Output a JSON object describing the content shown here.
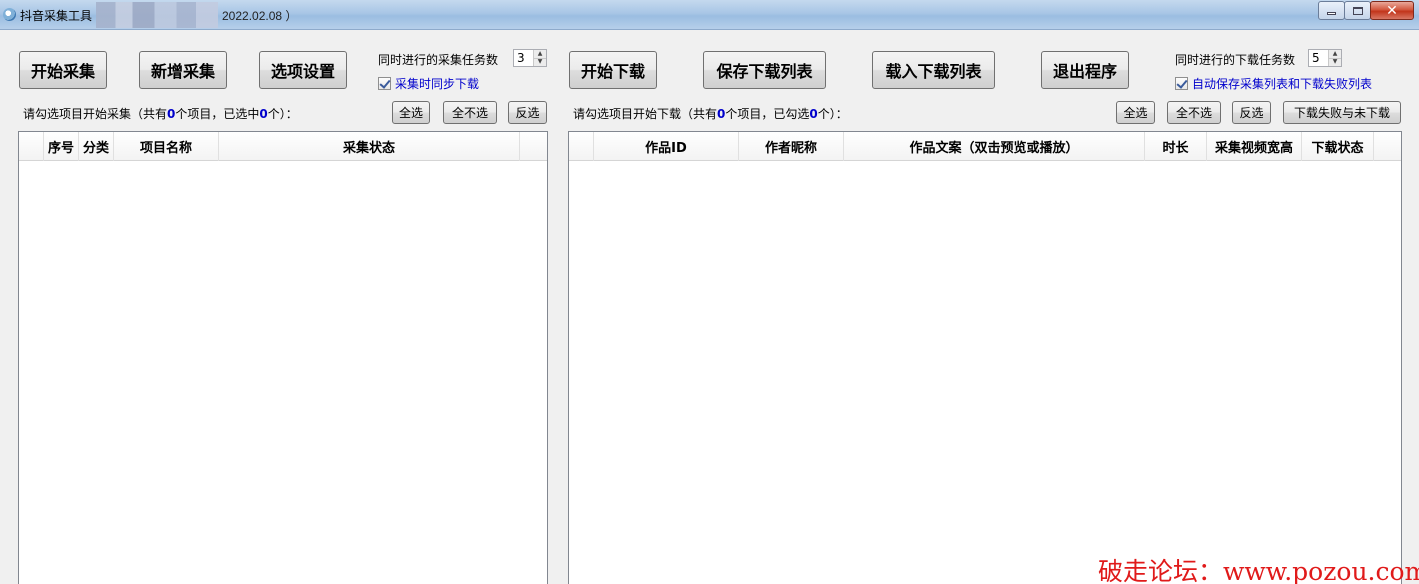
{
  "window": {
    "title": "抖音采集工具",
    "version": "2022.02.08 ）",
    "min_label": "",
    "max_label": "",
    "close_label": "✕"
  },
  "left": {
    "buttons": {
      "start_collect": "开始采集",
      "add_collect": "新增采集",
      "options": "选项设置"
    },
    "concurrent_label": "同时进行的采集任务数",
    "concurrent_value": "3",
    "sync_download_label": "采集时同步下载",
    "status": {
      "prefix": "请勾选项目开始采集（共有",
      "total": "0",
      "middle": "个项目，已选中",
      "selected": "0",
      "suffix": "个）："
    },
    "select_all": "全选",
    "select_none": "全不选",
    "invert": "反选",
    "columns": [
      "",
      "序号",
      "分类",
      "项目名称",
      "采集状态",
      ""
    ]
  },
  "right": {
    "buttons": {
      "start_download": "开始下载",
      "save_list": "保存下载列表",
      "load_list": "载入下载列表",
      "exit": "退出程序"
    },
    "concurrent_label": "同时进行的下载任务数",
    "concurrent_value": "5",
    "auto_save_label": "自动保存采集列表和下载失败列表",
    "status": {
      "prefix": "请勾选项目开始下载（共有",
      "total": "0",
      "middle": "个项目，已勾选",
      "selected": "0",
      "suffix": "个）："
    },
    "select_all": "全选",
    "select_none": "全不选",
    "invert": "反选",
    "failed_button": "下载失败与未下载",
    "columns": [
      "",
      "作品ID",
      "作者昵称",
      "作品文案（双击预览或播放）",
      "时长",
      "采集视频宽高",
      "下载状态",
      ""
    ]
  },
  "watermark": "破走论坛：www.pozou.com"
}
